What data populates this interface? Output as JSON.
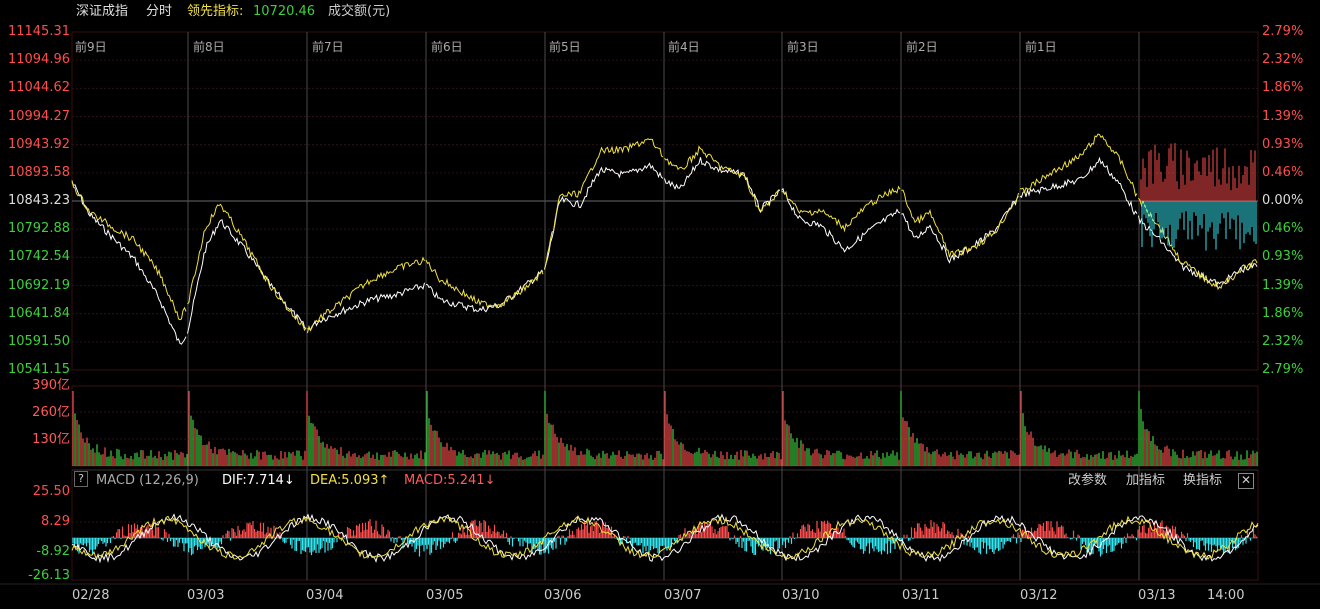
{
  "header": {
    "index_name": "深证成指",
    "mode": "分时",
    "leading_label": "领先指标:",
    "leading_value": "10720.46",
    "amount_label": "成交额(元)"
  },
  "price_axis": {
    "left": [
      "11145.31",
      "11094.96",
      "11044.62",
      "10994.27",
      "10943.92",
      "10893.58",
      "10843.23",
      "10792.88",
      "10742.54",
      "10692.19",
      "10641.84",
      "10591.50",
      "10541.15"
    ],
    "right": [
      "2.79%",
      "2.32%",
      "1.86%",
      "1.39%",
      "0.93%",
      "0.46%",
      "0.00%",
      "0.46%",
      "0.93%",
      "1.39%",
      "1.86%",
      "2.32%",
      "2.79%"
    ],
    "base": 10843.23,
    "max": 11145.31,
    "min": 10541.15
  },
  "day_labels": [
    "前9日",
    "前8日",
    "前7日",
    "前6日",
    "前5日",
    "前4日",
    "前3日",
    "前2日",
    "前1日"
  ],
  "volume_axis": [
    "390亿",
    "260亿",
    "130亿"
  ],
  "macd": {
    "help": "?",
    "title": "MACD (12,26,9)",
    "dif": "DIF:7.714↓",
    "dea": "DEA:5.093↑",
    "macd": "MACD:5.241↓",
    "axis": [
      "25.50",
      "8.29",
      "-8.92",
      "-26.13"
    ],
    "buttons": [
      "改参数",
      "加指标",
      "换指标"
    ],
    "close": "✕"
  },
  "x_labels": [
    "02/28",
    "03/03",
    "03/04",
    "03/05",
    "03/06",
    "03/07",
    "03/10",
    "03/11",
    "03/12",
    "03/13",
    "14:00"
  ],
  "colors": {
    "up": "#ff4d4d",
    "down": "#3cd03c",
    "price": "#ffffff",
    "leading": "#f0e040",
    "cyan": "#33e6f0",
    "grid": "#3a1010"
  }
}
